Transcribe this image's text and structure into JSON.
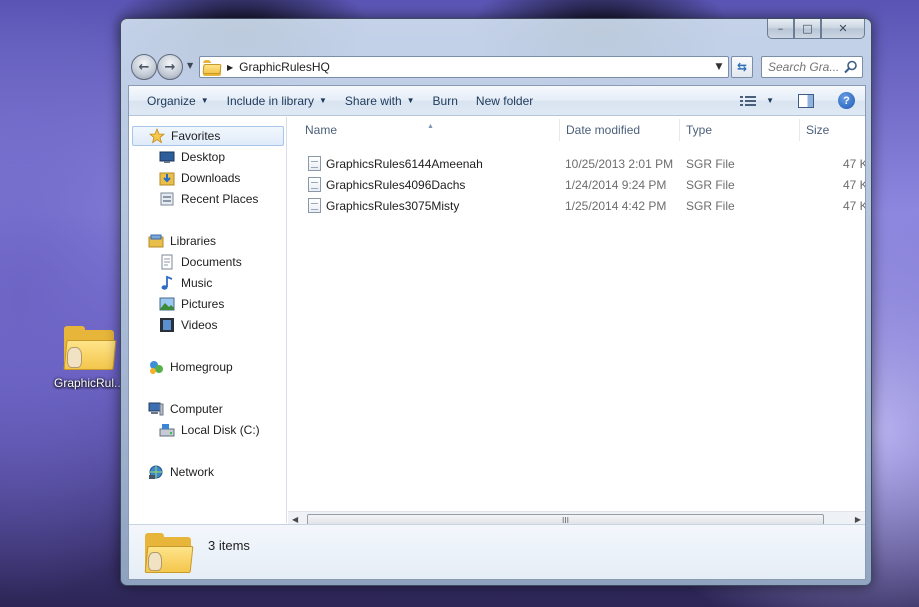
{
  "desktop": {
    "icon_label": "GraphicRul..."
  },
  "window": {
    "caption": {
      "minimize_glyph": "–",
      "maximize_glyph": "□",
      "close_glyph": "✕"
    },
    "address": {
      "crumb": "GraphicRulesHQ",
      "separator": "▶",
      "dropdown_glyph": "▼"
    },
    "search": {
      "placeholder": "Search Gra..."
    },
    "nav_back_glyph": "←",
    "nav_forward_glyph": "→",
    "refresh_glyph": "⇆"
  },
  "toolbar": {
    "items": [
      {
        "label": "Organize",
        "dropdown": true
      },
      {
        "label": "Include in library",
        "dropdown": true
      },
      {
        "label": "Share with",
        "dropdown": true
      },
      {
        "label": "Burn",
        "dropdown": false
      },
      {
        "label": "New folder",
        "dropdown": false
      }
    ],
    "dropdown_glyph": "▼",
    "help_glyph": "?"
  },
  "navpane": {
    "favorites": "Favorites",
    "desktop": "Desktop",
    "downloads": "Downloads",
    "recent_places": "Recent Places",
    "libraries": "Libraries",
    "documents": "Documents",
    "music": "Music",
    "pictures": "Pictures",
    "videos": "Videos",
    "homegroup": "Homegroup",
    "computer": "Computer",
    "local_disk": "Local Disk (C:)",
    "network": "Network"
  },
  "filelist": {
    "columns": {
      "name": "Name",
      "date_modified": "Date modified",
      "type": "Type",
      "size": "Size"
    },
    "rows": [
      {
        "name": "GraphicsRules6144Ameenah",
        "date": "10/25/2013 2:01 PM",
        "type": "SGR File",
        "size": "47 K"
      },
      {
        "name": "GraphicsRules4096Dachs",
        "date": "1/24/2014 9:24 PM",
        "type": "SGR File",
        "size": "47 K"
      },
      {
        "name": "GraphicsRules3075Misty",
        "date": "1/25/2014 4:42 PM",
        "type": "SGR File",
        "size": "47 K"
      }
    ],
    "scroll_left_glyph": "◀",
    "scroll_right_glyph": "▶",
    "scroll_grip": "III"
  },
  "details": {
    "item_count": "3 items"
  }
}
